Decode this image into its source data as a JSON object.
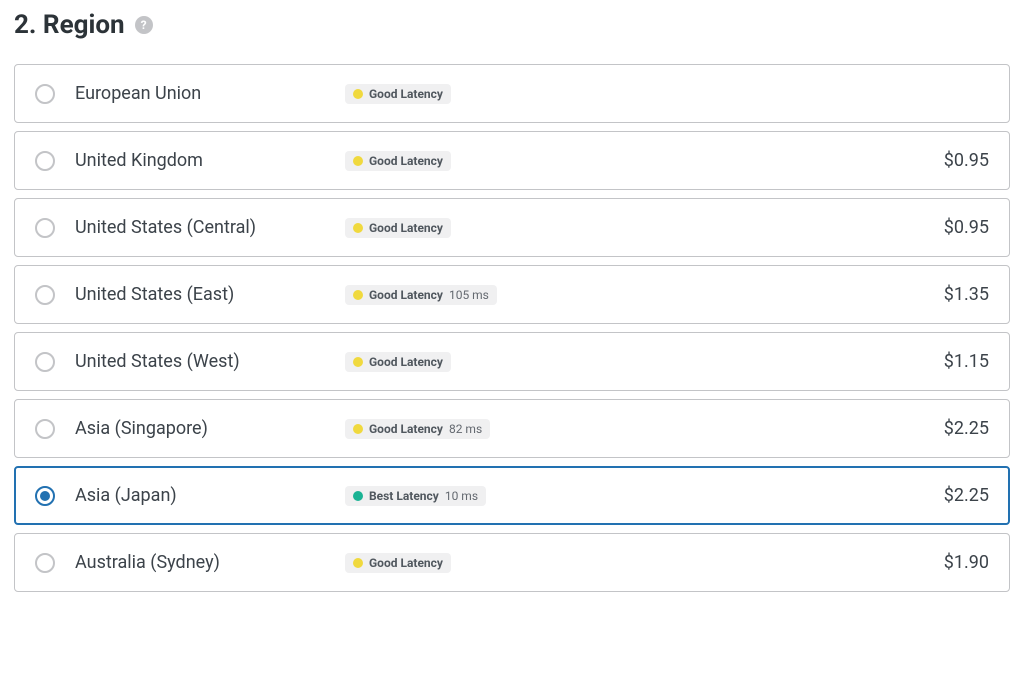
{
  "section": {
    "title": "2. Region",
    "help_tooltip": "?"
  },
  "latency": {
    "good_label": "Good Latency",
    "best_label": "Best Latency"
  },
  "regions": [
    {
      "id": "eu",
      "name": "European Union",
      "latency": "good",
      "ms": "",
      "price": "",
      "selected": false
    },
    {
      "id": "uk",
      "name": "United Kingdom",
      "latency": "good",
      "ms": "",
      "price": "$0.95",
      "selected": false
    },
    {
      "id": "us-central",
      "name": "United States (Central)",
      "latency": "good",
      "ms": "",
      "price": "$0.95",
      "selected": false
    },
    {
      "id": "us-east",
      "name": "United States (East)",
      "latency": "good",
      "ms": "105 ms",
      "price": "$1.35",
      "selected": false
    },
    {
      "id": "us-west",
      "name": "United States (West)",
      "latency": "good",
      "ms": "",
      "price": "$1.15",
      "selected": false
    },
    {
      "id": "asia-singapore",
      "name": "Asia (Singapore)",
      "latency": "good",
      "ms": "82 ms",
      "price": "$2.25",
      "selected": false
    },
    {
      "id": "asia-japan",
      "name": "Asia (Japan)",
      "latency": "best",
      "ms": "10 ms",
      "price": "$2.25",
      "selected": true
    },
    {
      "id": "au-sydney",
      "name": "Australia (Sydney)",
      "latency": "good",
      "ms": "",
      "price": "$1.90",
      "selected": false
    }
  ]
}
